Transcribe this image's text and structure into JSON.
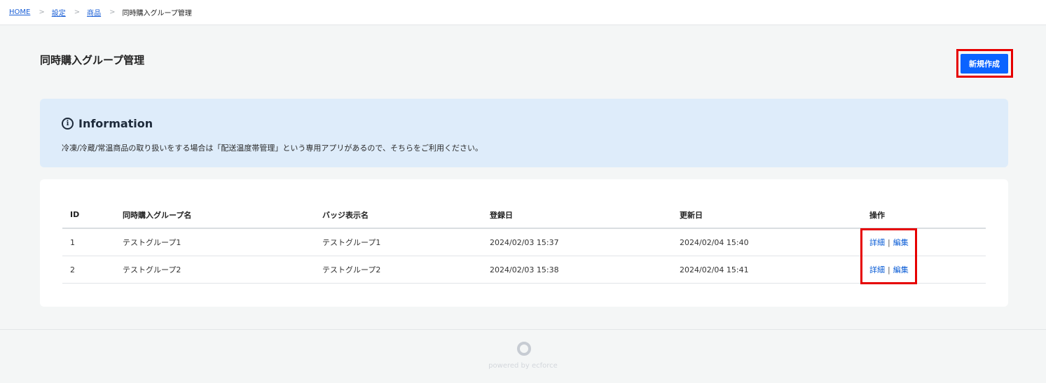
{
  "breadcrumb": {
    "items": [
      "HOME",
      "設定",
      "商品"
    ],
    "separator": ">",
    "current": "同時購入グループ管理"
  },
  "page": {
    "title": "同時購入グループ管理",
    "new_button_label": "新規作成"
  },
  "info": {
    "icon": "info-circle-icon",
    "title": "Information",
    "text": "冷凍/冷蔵/常温商品の取り扱いをする場合は「配送温度帯管理」という専用アプリがあるので、そちらをご利用ください。"
  },
  "table": {
    "headers": [
      "ID",
      "同時購入グループ名",
      "バッジ表示名",
      "登録日",
      "更新日",
      "操作"
    ],
    "rows": [
      {
        "id": "1",
        "name": "テストグループ1",
        "badge": "テストグループ1",
        "registered": "2024/02/03 15:37",
        "updated": "2024/02/04 15:40",
        "detail": "詳細",
        "sep": "|",
        "edit": "編集"
      },
      {
        "id": "2",
        "name": "テストグループ2",
        "badge": "テストグループ2",
        "registered": "2024/02/03 15:38",
        "updated": "2024/02/04 15:41",
        "detail": "詳細",
        "sep": "|",
        "edit": "編集"
      }
    ]
  },
  "footer": {
    "text": "powered by ecforce"
  },
  "colors": {
    "accent": "#0a63ff",
    "highlight": "#e60000",
    "info_bg": "#deecfa",
    "link": "#0a5cd6"
  }
}
